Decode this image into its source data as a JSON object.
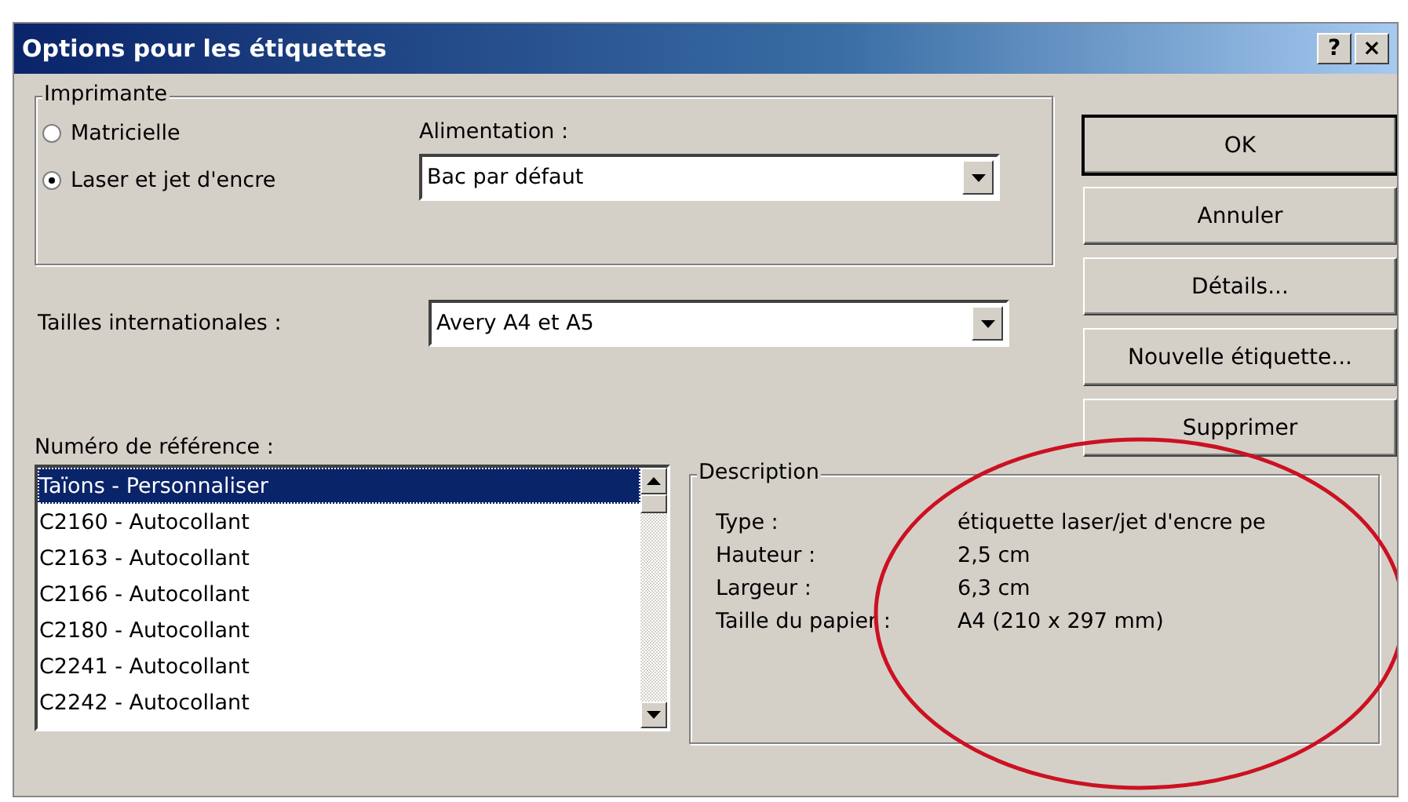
{
  "window": {
    "title": "Options pour les étiquettes",
    "help": "?",
    "close": "×"
  },
  "printer": {
    "legend": "Imprimante",
    "options": [
      {
        "label": "Matricielle",
        "selected": false
      },
      {
        "label": "Laser et jet d'encre",
        "selected": true
      }
    ],
    "feed": {
      "label": "Alimentation :",
      "value": "Bac par défaut"
    }
  },
  "sizes": {
    "label": "Tailles internationales :",
    "value": "Avery A4 et A5"
  },
  "buttons": [
    {
      "label": "OK",
      "default": true
    },
    {
      "label": "Annuler",
      "default": false
    },
    {
      "label": "Détails...",
      "default": false
    },
    {
      "label": "Nouvelle étiquette...",
      "default": false
    },
    {
      "label": "Supprimer",
      "default": false
    }
  ],
  "reference": {
    "label": "Numéro de référence :",
    "items": [
      {
        "label": "Taïons - Personnaliser",
        "selected": true
      },
      {
        "label": "C2160 - Autocollant",
        "selected": false
      },
      {
        "label": "C2163 - Autocollant",
        "selected": false
      },
      {
        "label": "C2166 - Autocollant",
        "selected": false
      },
      {
        "label": "C2180 - Autocollant",
        "selected": false
      },
      {
        "label": "C2241 - Autocollant",
        "selected": false
      },
      {
        "label": "C2242 - Autocollant",
        "selected": false
      }
    ]
  },
  "description": {
    "legend": "Description",
    "rows": [
      {
        "label": "Type :",
        "value": "étiquette laser/jet d'encre pe"
      },
      {
        "label": "Hauteur :",
        "value": "2,5 cm"
      },
      {
        "label": "Largeur :",
        "value": "6,3 cm"
      },
      {
        "label": "Taille du papier :",
        "value": "A4 (210 x 297 mm)"
      }
    ]
  },
  "annotation": {
    "kind": "ellipse",
    "color": "#cc1122"
  }
}
